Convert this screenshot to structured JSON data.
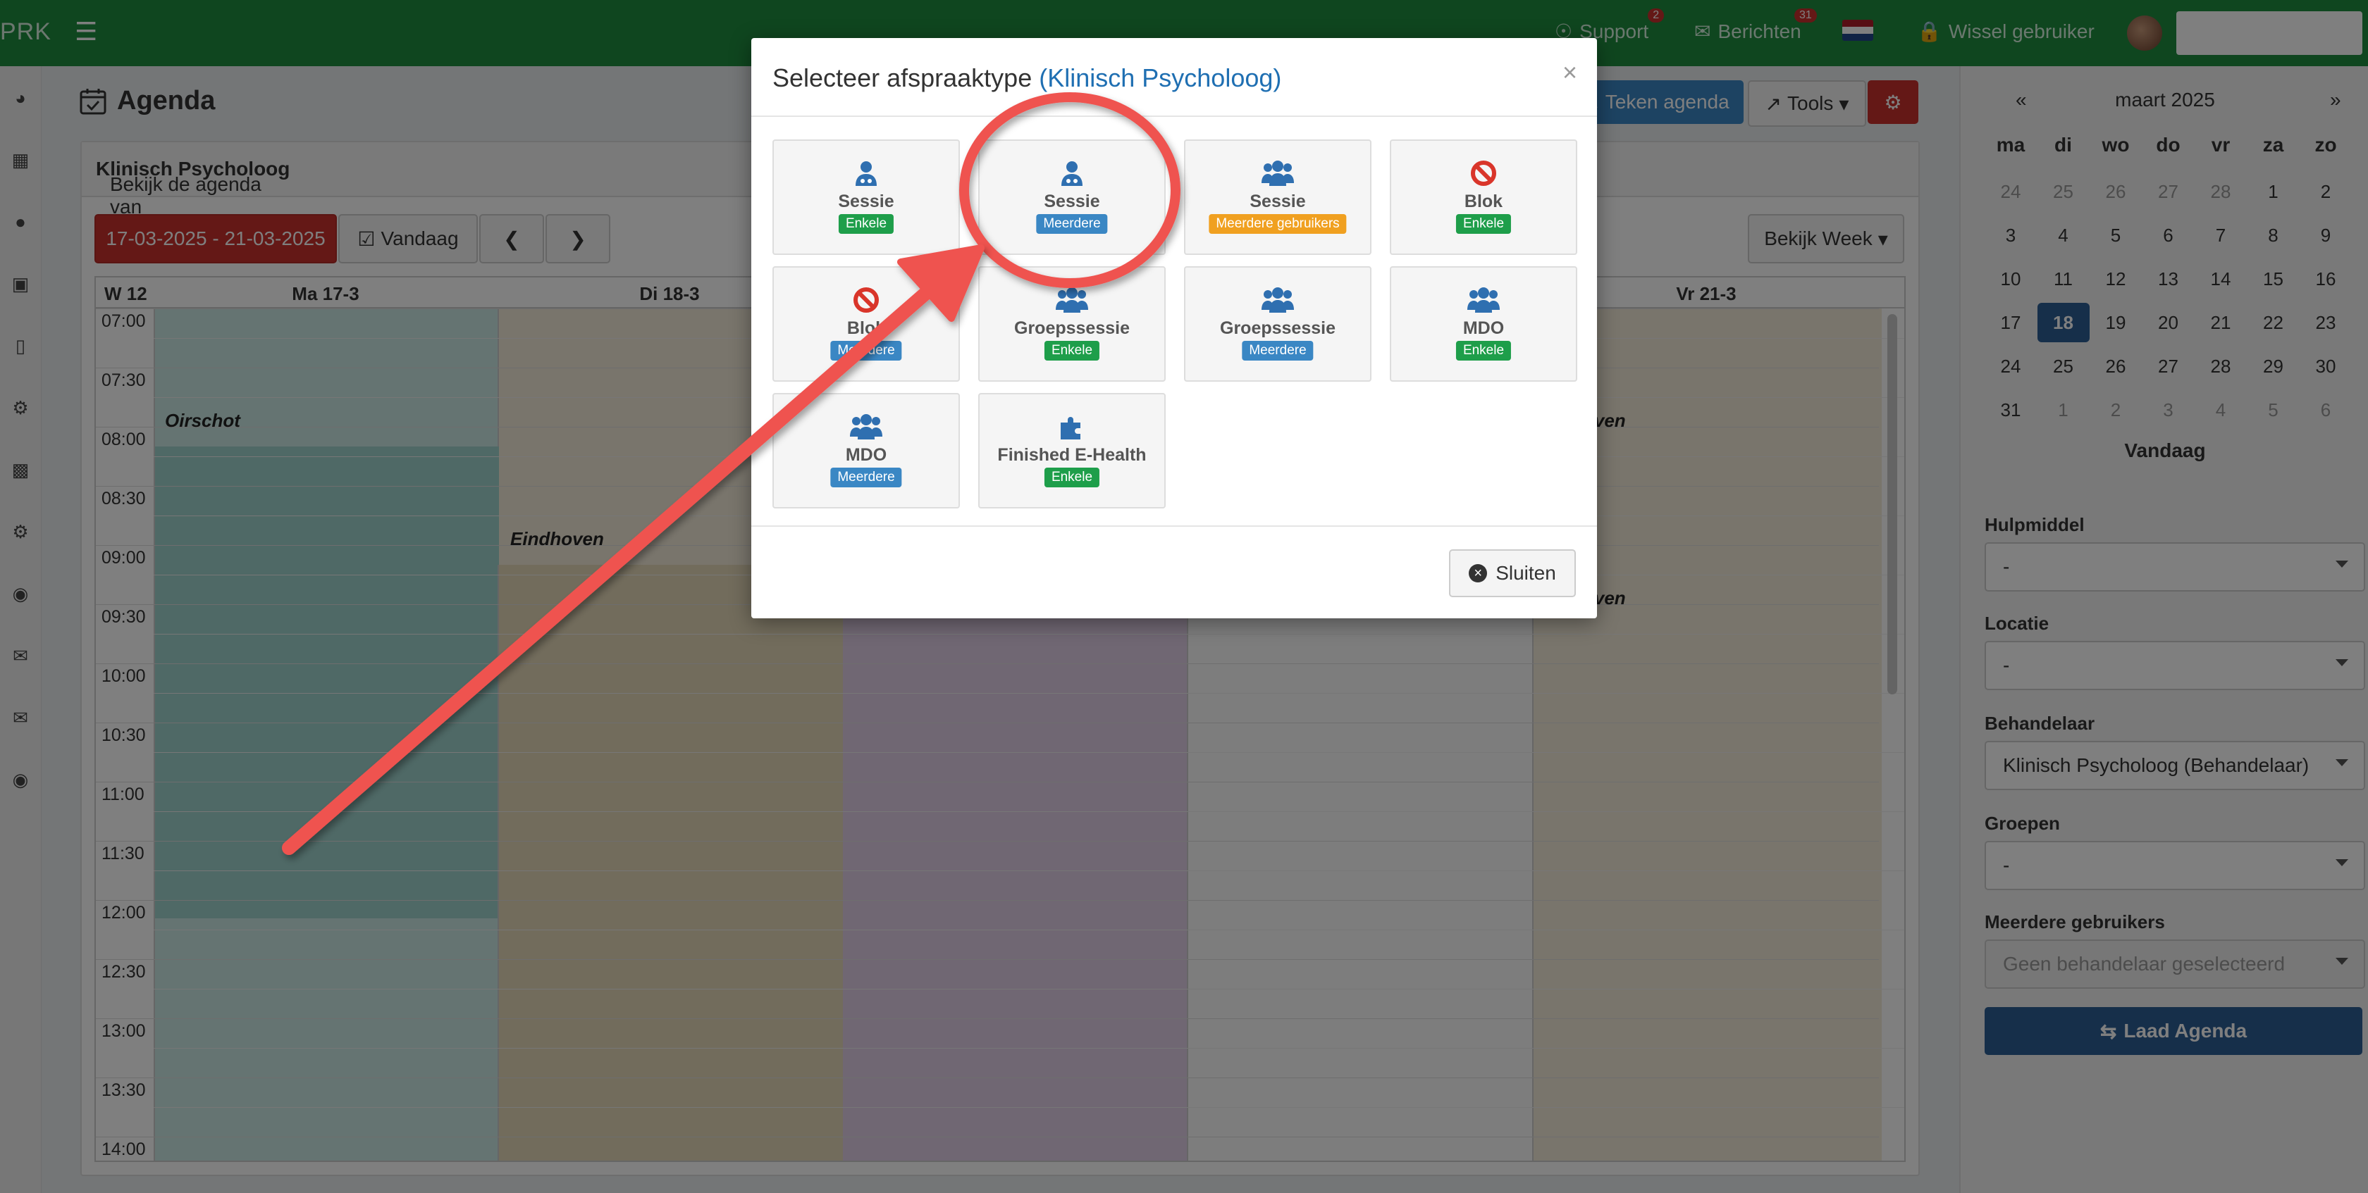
{
  "topbar": {
    "brand": "PRK",
    "support_label": "Support",
    "support_count": "2",
    "messages_label": "Berichten",
    "messages_count": "31",
    "switch_user_label": "Wissel gebruiker"
  },
  "page": {
    "title": "Agenda",
    "teken_agenda": "Teken agenda",
    "tools": "Tools",
    "view_text_prefix": "Bekijk de agenda van ",
    "view_text_name": "Klinisch Psycholoog"
  },
  "toolbar": {
    "date_range": "17-03-2025 - 21-03-2025",
    "today": "Vandaag",
    "view_week": "Bekijk Week"
  },
  "calendar": {
    "week": "W 12",
    "days": [
      "Ma 17-3",
      "Di 18-3",
      "Vr 21-3"
    ],
    "times": [
      "07:00",
      "07:30",
      "08:00",
      "08:30",
      "09:00",
      "09:30",
      "10:00",
      "10:30",
      "11:00",
      "11:30",
      "12:00",
      "12:30",
      "13:00",
      "13:30",
      "14:00"
    ],
    "locations": {
      "oirschot": "Oirschot",
      "eindhoven": "Eindhoven",
      "partial_1": "oven",
      "partial_2": "oven"
    }
  },
  "mini_calendar": {
    "prev": "«",
    "next": "»",
    "title": "maart 2025",
    "dow": [
      "ma",
      "di",
      "wo",
      "do",
      "vr",
      "za",
      "zo"
    ],
    "weeks": [
      [
        "24",
        "25",
        "26",
        "27",
        "28",
        "1",
        "2"
      ],
      [
        "3",
        "4",
        "5",
        "6",
        "7",
        "8",
        "9"
      ],
      [
        "10",
        "11",
        "12",
        "13",
        "14",
        "15",
        "16"
      ],
      [
        "17",
        "18",
        "19",
        "20",
        "21",
        "22",
        "23"
      ],
      [
        "24",
        "25",
        "26",
        "27",
        "28",
        "29",
        "30"
      ],
      [
        "31",
        "1",
        "2",
        "3",
        "4",
        "5",
        "6"
      ]
    ],
    "today": "Vandaag"
  },
  "filters": {
    "hulpmiddel_label": "Hulpmiddel",
    "hulpmiddel_value": "-",
    "locatie_label": "Locatie",
    "locatie_value": "-",
    "behandelaar_label": "Behandelaar",
    "behandelaar_value": "Klinisch Psycholoog (Behandelaar)",
    "groepen_label": "Groepen",
    "groepen_value": "-",
    "meerdere_label": "Meerdere gebruikers",
    "meerdere_placeholder": "Geen behandelaar geselecteerd",
    "load_button": "Laad Agenda"
  },
  "modal": {
    "title": "Selecteer afspraaktype",
    "title_accent": "(Klinisch Psycholoog)",
    "close_label": "Sluiten",
    "tiles": [
      {
        "name": "Sessie",
        "badge": "Enkele",
        "badge_color": "#1e9e4a",
        "icon": "user-doctor-icon"
      },
      {
        "name": "Sessie",
        "badge": "Meerdere",
        "badge_color": "#3a87c4",
        "icon": "user-doctor-icon"
      },
      {
        "name": "Sessie",
        "badge": "Meerdere gebruikers",
        "badge_color": "#f0a020",
        "icon": "users-icon"
      },
      {
        "name": "Blok",
        "badge": "Enkele",
        "badge_color": "#1e9e4a",
        "icon": "ban-icon"
      },
      {
        "name": "Blok",
        "badge": "Meerdere",
        "badge_color": "#3a87c4",
        "icon": "ban-icon"
      },
      {
        "name": "Groepssessie",
        "badge": "Enkele",
        "badge_color": "#1e9e4a",
        "icon": "users-icon"
      },
      {
        "name": "Groepssessie",
        "badge": "Meerdere",
        "badge_color": "#3a87c4",
        "icon": "users-icon"
      },
      {
        "name": "MDO",
        "badge": "Enkele",
        "badge_color": "#1e9e4a",
        "icon": "users-icon"
      },
      {
        "name": "MDO",
        "badge": "Meerdere",
        "badge_color": "#3a87c4",
        "icon": "users-icon"
      },
      {
        "name": "Finished E-Health",
        "badge": "Enkele",
        "badge_color": "#1e9e4a",
        "icon": "puzzle-icon"
      }
    ]
  },
  "colors": {
    "topbar": "#1e8d3f",
    "accent_blue": "#2c5e95",
    "danger": "#c9302c",
    "annotation": "#ef5350"
  }
}
